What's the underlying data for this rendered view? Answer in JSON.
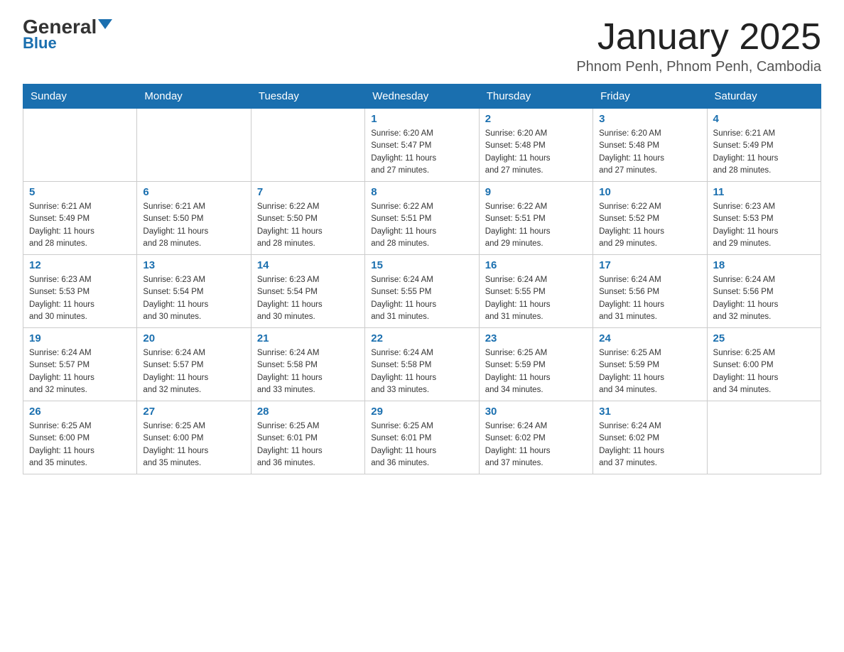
{
  "header": {
    "logo_general": "General",
    "logo_blue": "Blue",
    "title": "January 2025",
    "subtitle": "Phnom Penh, Phnom Penh, Cambodia"
  },
  "days_of_week": [
    "Sunday",
    "Monday",
    "Tuesday",
    "Wednesday",
    "Thursday",
    "Friday",
    "Saturday"
  ],
  "weeks": [
    [
      {
        "day": "",
        "info": ""
      },
      {
        "day": "",
        "info": ""
      },
      {
        "day": "",
        "info": ""
      },
      {
        "day": "1",
        "info": "Sunrise: 6:20 AM\nSunset: 5:47 PM\nDaylight: 11 hours\nand 27 minutes."
      },
      {
        "day": "2",
        "info": "Sunrise: 6:20 AM\nSunset: 5:48 PM\nDaylight: 11 hours\nand 27 minutes."
      },
      {
        "day": "3",
        "info": "Sunrise: 6:20 AM\nSunset: 5:48 PM\nDaylight: 11 hours\nand 27 minutes."
      },
      {
        "day": "4",
        "info": "Sunrise: 6:21 AM\nSunset: 5:49 PM\nDaylight: 11 hours\nand 28 minutes."
      }
    ],
    [
      {
        "day": "5",
        "info": "Sunrise: 6:21 AM\nSunset: 5:49 PM\nDaylight: 11 hours\nand 28 minutes."
      },
      {
        "day": "6",
        "info": "Sunrise: 6:21 AM\nSunset: 5:50 PM\nDaylight: 11 hours\nand 28 minutes."
      },
      {
        "day": "7",
        "info": "Sunrise: 6:22 AM\nSunset: 5:50 PM\nDaylight: 11 hours\nand 28 minutes."
      },
      {
        "day": "8",
        "info": "Sunrise: 6:22 AM\nSunset: 5:51 PM\nDaylight: 11 hours\nand 28 minutes."
      },
      {
        "day": "9",
        "info": "Sunrise: 6:22 AM\nSunset: 5:51 PM\nDaylight: 11 hours\nand 29 minutes."
      },
      {
        "day": "10",
        "info": "Sunrise: 6:22 AM\nSunset: 5:52 PM\nDaylight: 11 hours\nand 29 minutes."
      },
      {
        "day": "11",
        "info": "Sunrise: 6:23 AM\nSunset: 5:53 PM\nDaylight: 11 hours\nand 29 minutes."
      }
    ],
    [
      {
        "day": "12",
        "info": "Sunrise: 6:23 AM\nSunset: 5:53 PM\nDaylight: 11 hours\nand 30 minutes."
      },
      {
        "day": "13",
        "info": "Sunrise: 6:23 AM\nSunset: 5:54 PM\nDaylight: 11 hours\nand 30 minutes."
      },
      {
        "day": "14",
        "info": "Sunrise: 6:23 AM\nSunset: 5:54 PM\nDaylight: 11 hours\nand 30 minutes."
      },
      {
        "day": "15",
        "info": "Sunrise: 6:24 AM\nSunset: 5:55 PM\nDaylight: 11 hours\nand 31 minutes."
      },
      {
        "day": "16",
        "info": "Sunrise: 6:24 AM\nSunset: 5:55 PM\nDaylight: 11 hours\nand 31 minutes."
      },
      {
        "day": "17",
        "info": "Sunrise: 6:24 AM\nSunset: 5:56 PM\nDaylight: 11 hours\nand 31 minutes."
      },
      {
        "day": "18",
        "info": "Sunrise: 6:24 AM\nSunset: 5:56 PM\nDaylight: 11 hours\nand 32 minutes."
      }
    ],
    [
      {
        "day": "19",
        "info": "Sunrise: 6:24 AM\nSunset: 5:57 PM\nDaylight: 11 hours\nand 32 minutes."
      },
      {
        "day": "20",
        "info": "Sunrise: 6:24 AM\nSunset: 5:57 PM\nDaylight: 11 hours\nand 32 minutes."
      },
      {
        "day": "21",
        "info": "Sunrise: 6:24 AM\nSunset: 5:58 PM\nDaylight: 11 hours\nand 33 minutes."
      },
      {
        "day": "22",
        "info": "Sunrise: 6:24 AM\nSunset: 5:58 PM\nDaylight: 11 hours\nand 33 minutes."
      },
      {
        "day": "23",
        "info": "Sunrise: 6:25 AM\nSunset: 5:59 PM\nDaylight: 11 hours\nand 34 minutes."
      },
      {
        "day": "24",
        "info": "Sunrise: 6:25 AM\nSunset: 5:59 PM\nDaylight: 11 hours\nand 34 minutes."
      },
      {
        "day": "25",
        "info": "Sunrise: 6:25 AM\nSunset: 6:00 PM\nDaylight: 11 hours\nand 34 minutes."
      }
    ],
    [
      {
        "day": "26",
        "info": "Sunrise: 6:25 AM\nSunset: 6:00 PM\nDaylight: 11 hours\nand 35 minutes."
      },
      {
        "day": "27",
        "info": "Sunrise: 6:25 AM\nSunset: 6:00 PM\nDaylight: 11 hours\nand 35 minutes."
      },
      {
        "day": "28",
        "info": "Sunrise: 6:25 AM\nSunset: 6:01 PM\nDaylight: 11 hours\nand 36 minutes."
      },
      {
        "day": "29",
        "info": "Sunrise: 6:25 AM\nSunset: 6:01 PM\nDaylight: 11 hours\nand 36 minutes."
      },
      {
        "day": "30",
        "info": "Sunrise: 6:24 AM\nSunset: 6:02 PM\nDaylight: 11 hours\nand 37 minutes."
      },
      {
        "day": "31",
        "info": "Sunrise: 6:24 AM\nSunset: 6:02 PM\nDaylight: 11 hours\nand 37 minutes."
      },
      {
        "day": "",
        "info": ""
      }
    ]
  ]
}
